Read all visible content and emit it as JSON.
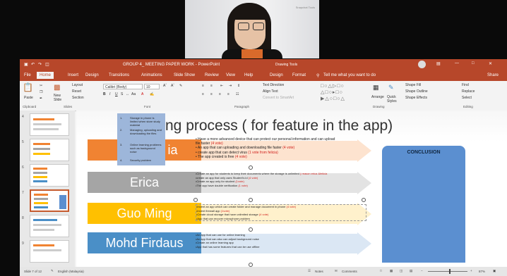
{
  "webcam": {
    "label": "Snapchat Tools"
  },
  "titlebar": {
    "title": "GROUP 4_ MEETING PAPER WORK - PowerPoint",
    "doc_tools": "Drawing Tools"
  },
  "tabs": [
    "File",
    "Home",
    "Insert",
    "Design",
    "Transitions",
    "Animations",
    "Slide Show",
    "Review",
    "View",
    "Help",
    "Design",
    "Format"
  ],
  "tell_me": "Tell me what you want to do",
  "share": "Share",
  "ribbon": {
    "paste": "Paste",
    "new_slide": "New Slide",
    "layout": "Layout",
    "reset": "Reset",
    "section": "Section",
    "font_name": "Calibri (Body)",
    "font_size": "10",
    "text_direction": "Text Direction",
    "align_text": "Align Text",
    "convert_smartart": "Convert to SmartArt",
    "arrange": "Arrange",
    "quick_styles": "Quick Styles",
    "shape_fill": "Shape Fill",
    "shape_outline": "Shape Outline",
    "shape_effects": "Shape Effects",
    "find": "Find",
    "replace": "Replace",
    "select": "Select",
    "groups": [
      "Clipboard",
      "Slides",
      "Font",
      "Paragraph",
      "Drawing",
      "Editing"
    ]
  },
  "thumbnails": [
    "4",
    "5",
    "6",
    "7",
    "8",
    "9"
  ],
  "slide": {
    "title": "ng process ( for feature in the app)",
    "partial_name": "ia",
    "sticky": [
      "1.",
      "Storage in phone is limited when store study material",
      "2.",
      "Managing, uploading and downloading the files",
      "3.",
      "Online learning problems such as background noise",
      "4.",
      "Security problem"
    ],
    "rows": [
      {
        "name": "",
        "color": "#f08332",
        "bullets": [
          {
            "text": "• Have a more advanced device that can protect our personal information and can upload file faster ",
            "votes": "(4 vote)"
          },
          {
            "text": "• An app that can uploading and downloading file faster ",
            "votes": "(4 vote)"
          },
          {
            "text": "• create app that can detect virus ",
            "votes": "(1 vote from felicia)"
          },
          {
            "text": "• The app created is free ",
            "votes": "(4 vote)"
          }
        ]
      },
      {
        "name": "Erica",
        "color": "#a5a5a5",
        "bullets": [
          {
            "text": "•Create an app for students to keep their documents where the storage is unlimited ",
            "votes": "( reason erica &felicia"
          },
          {
            "text": "•create an app that only uses Student's id ",
            "votes": "(4 vote)"
          },
          {
            "text": "•Create an app only for student ",
            "votes": "(1vote)"
          },
          {
            "text": "•The app have double verification ",
            "votes": "(1 vote)"
          }
        ]
      },
      {
        "name": "Guo Ming",
        "color": "#ffc000",
        "bullets": [
          {
            "text": "•Invent an app which can create folder and manage document in phone ",
            "votes": "(4 vote)"
          },
          {
            "text": "•Invent firewall app ",
            "votes": "(1vote)"
          },
          {
            "text": "•Create cloud storage that have unlimited storage ",
            "votes": "(4 vote)"
          },
          {
            "text": "•App that can recover microphone problem",
            "votes": ""
          }
        ]
      },
      {
        "name": "Mohd Firdaus",
        "color": "#4a8fc7",
        "bullets": [
          {
            "text": "•An app that can use for online learning",
            "votes": ""
          },
          {
            "text": "•An app that can also can adjust background noise",
            "votes": ""
          },
          {
            "text": "•Create an online learning app",
            "votes": ""
          },
          {
            "text": "•App that has some features that can be use offline",
            "votes": ""
          }
        ]
      }
    ],
    "conclusion": "CONCLUSION"
  },
  "statusbar": {
    "slide_info": "Slide 7 of 12",
    "language": "English (Malaysia)",
    "notes": "Notes",
    "comments": "Comments",
    "zoom": "87%"
  },
  "colors": {
    "accent": "#b7472a",
    "conclusion_fill": "#5b8fd0",
    "sticky_fill": "#9db6da"
  }
}
